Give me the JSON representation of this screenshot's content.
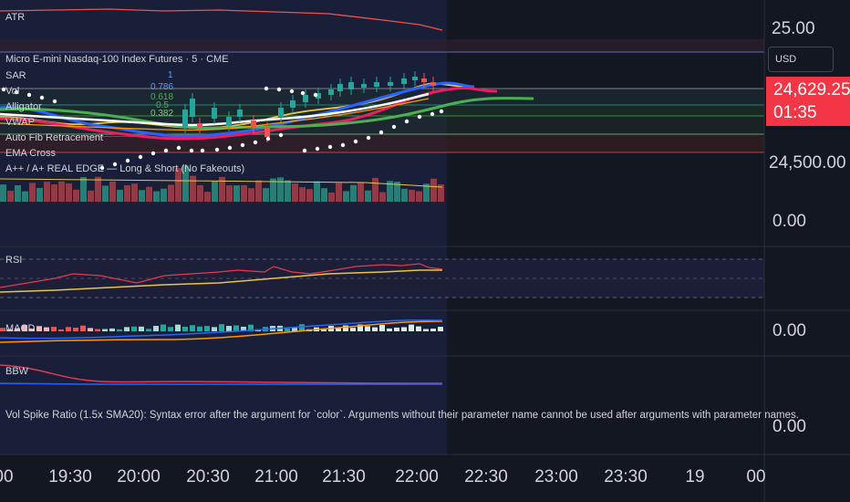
{
  "header": {
    "symbol_title": "Micro E-mini Nasdaq-100 Index Futures · 5 · CME"
  },
  "indicators": {
    "atr": "ATR",
    "sar": "SAR",
    "vol": "Vol",
    "alligator": "Alligator",
    "vwap": "VWAP",
    "fib": "Auto Fib Retracement",
    "ema": "EMA Cross",
    "edge": "A++ / A+ REAL EDGE — Long & Short (No Fakeouts)",
    "rsi": "RSI",
    "macd": "MACD",
    "bbw": "BBW"
  },
  "fib_levels": [
    "1",
    "0.786",
    "0.618",
    "0.5",
    "0.382"
  ],
  "error_message": "Vol Spike Ratio (1.5x SMA20): Syntax error after the argument for `color`. Arguments without their parameter name cannot be used after arguments with parameter names.",
  "price_axis": {
    "top_value": "25.00",
    "currency": "USD",
    "last_price": "24,629.25",
    "countdown": "01:35",
    "mid_value": "24,500.00",
    "vol_zero": "0.00",
    "macd_zero": "0.00",
    "bbw_zero": "0.00"
  },
  "time_axis": [
    "00",
    "19:30",
    "20:00",
    "20:30",
    "21:00",
    "21:30",
    "22:00",
    "22:30",
    "23:00",
    "23:30",
    "19",
    "00"
  ],
  "colors": {
    "background": "#131722",
    "last_price_badge": "#f23645",
    "up": "#26a69a",
    "down": "#ef5350",
    "blue_line": "#2962ff",
    "orange": "#ff9800",
    "pink": "#e91e63",
    "green": "#4caf50"
  }
}
